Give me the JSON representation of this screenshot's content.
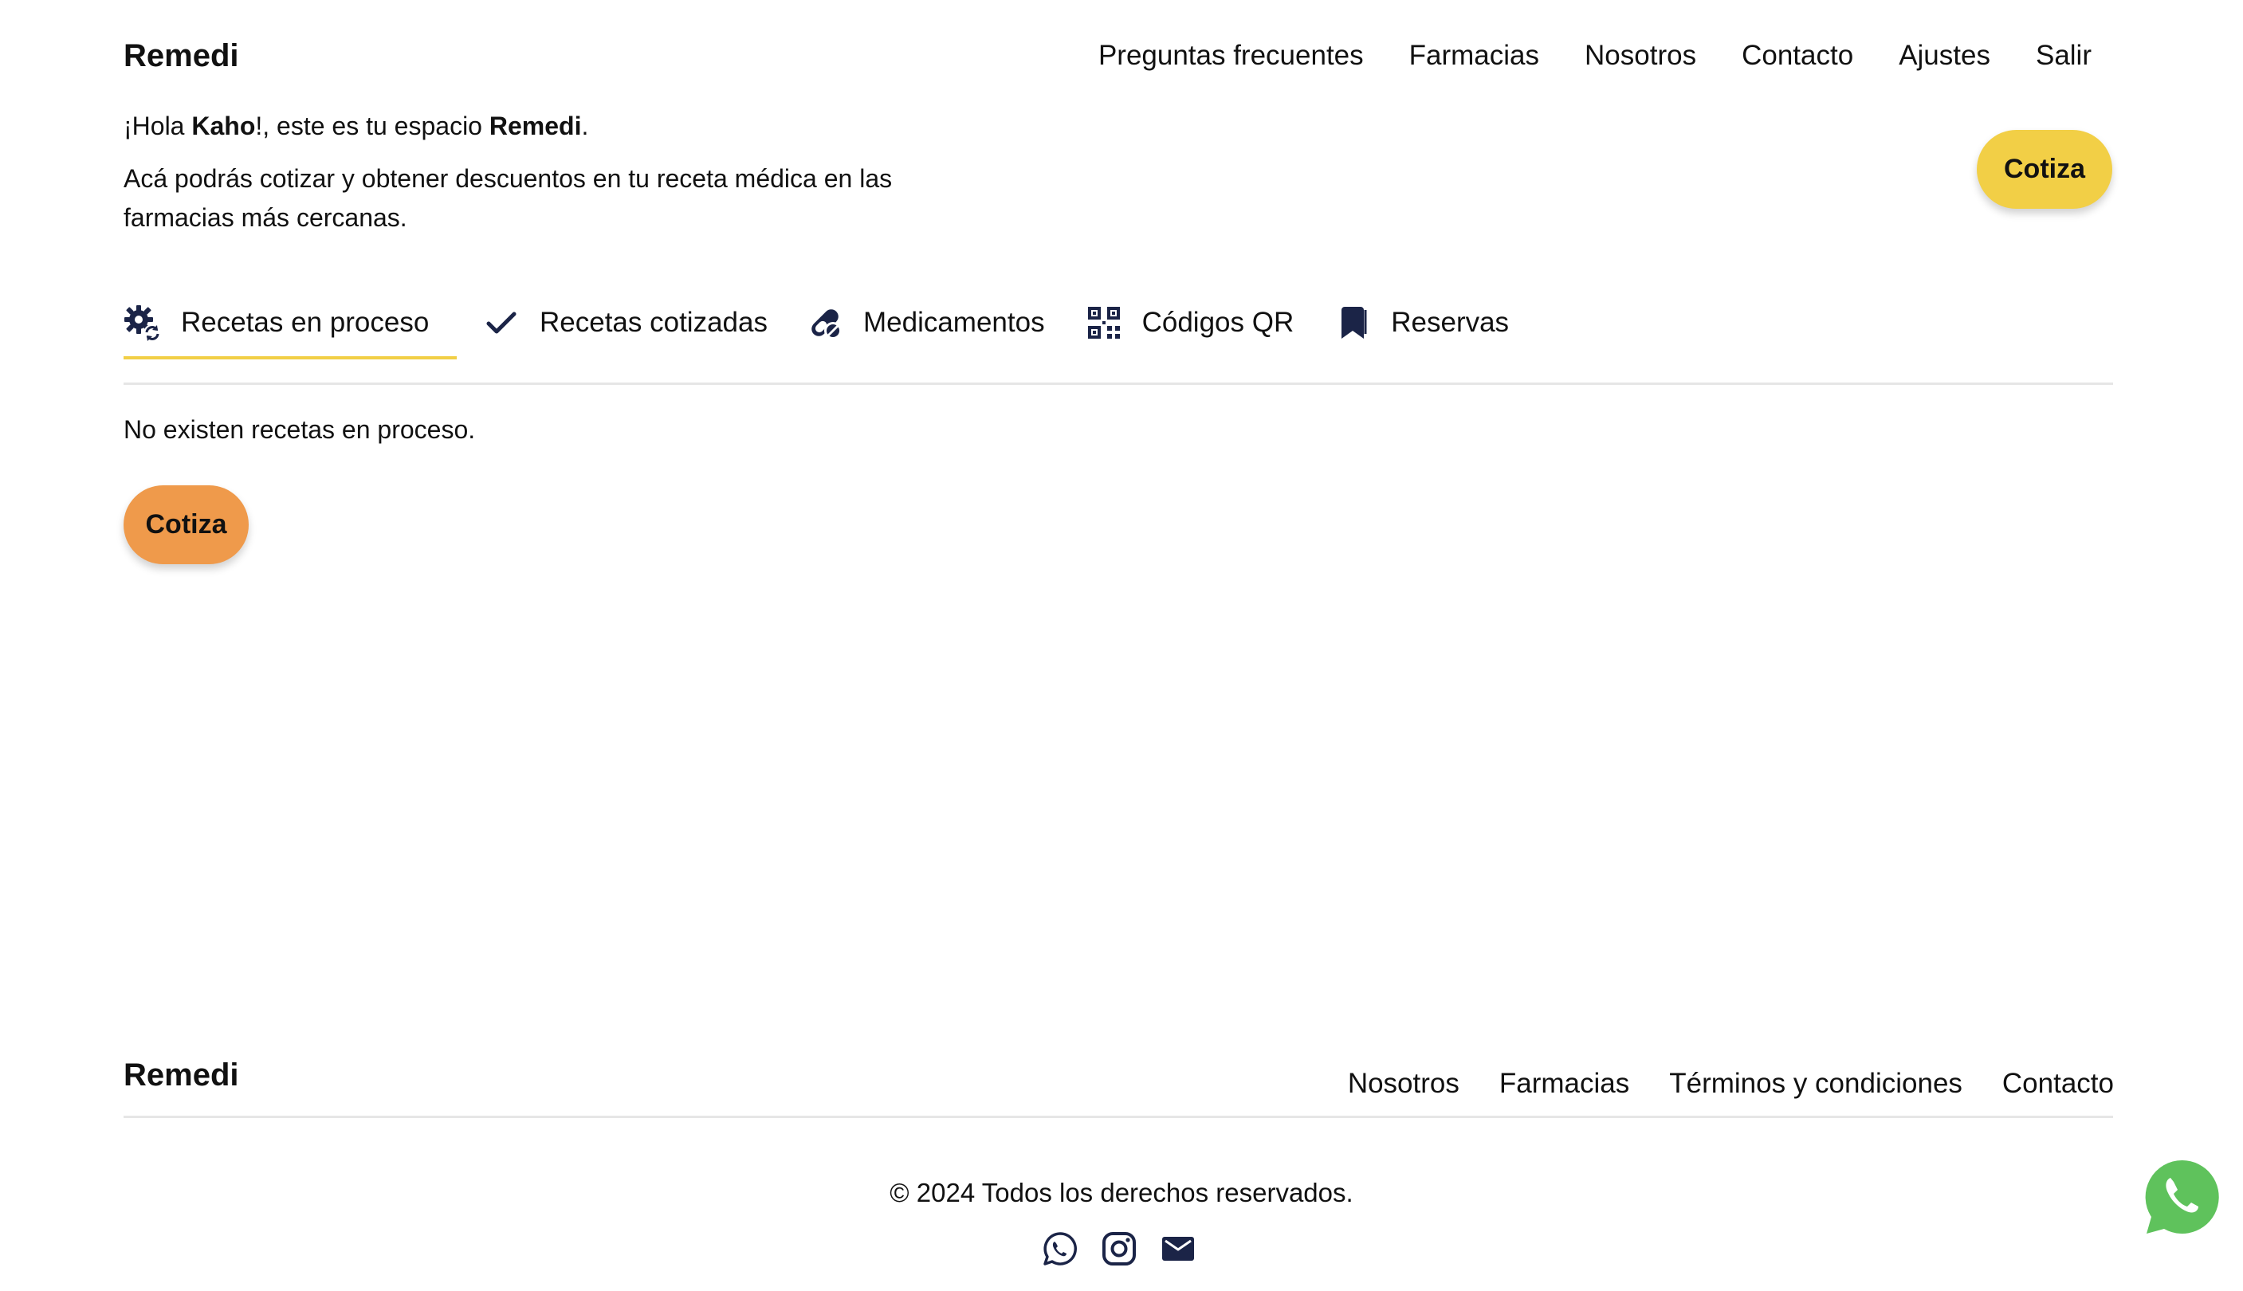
{
  "header": {
    "logo": "Remedi",
    "nav": [
      "Preguntas frecuentes",
      "Farmacias",
      "Nosotros",
      "Contacto",
      "Ajustes",
      "Salir"
    ]
  },
  "greeting": {
    "prefix": "¡Hola ",
    "name": "Kaho",
    "middle": "!, este es tu espacio ",
    "brand": "Remedi",
    "suffix": ".",
    "description": "Acá podrás cotizar y obtener descuentos en tu receta médica en las farmacias más cercanas."
  },
  "cta_top": {
    "label": "Cotiza"
  },
  "tabs": [
    {
      "label": "Recetas en proceso",
      "icon": "gear-refresh-icon",
      "active": true
    },
    {
      "label": "Recetas cotizadas",
      "icon": "check-icon"
    },
    {
      "label": "Medicamentos",
      "icon": "pills-icon"
    },
    {
      "label": "Códigos QR",
      "icon": "qr-code-icon"
    },
    {
      "label": "Reservas",
      "icon": "bookmark-icon"
    }
  ],
  "content": {
    "empty_message": "No existen recetas en proceso.",
    "cta_label": "Cotiza"
  },
  "footer": {
    "logo": "Remedi",
    "links": [
      "Nosotros",
      "Farmacias",
      "Términos y condiciones",
      "Contacto"
    ],
    "copyright": "© 2024 Todos los derechos reservados.",
    "social_icons": [
      "whatsapp-icon",
      "instagram-icon",
      "mail-icon"
    ]
  },
  "colors": {
    "accent_yellow": "#f2cf46",
    "accent_orange": "#ef9a4b",
    "icon_navy": "#1b2447",
    "whatsapp_green": "#5fc25c"
  }
}
